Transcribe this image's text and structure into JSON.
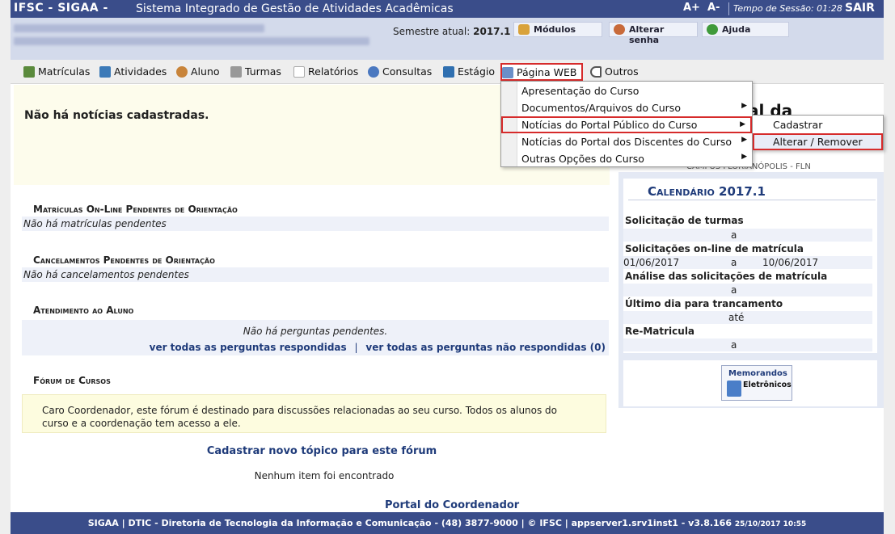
{
  "header": {
    "brand": "IFSC - SIGAA -",
    "system_name": "Sistema Integrado de Gestão de Atividades Acadêmicas",
    "font_increase": "A+",
    "font_decrease": "A-",
    "session_label": "Tempo de Sessão: 01:28",
    "exit_label": "SAIR"
  },
  "user": {
    "semester_label": "Semestre atual:",
    "semester_value": "2017.1",
    "buttons": {
      "modules": "Módulos",
      "change_password": "Alterar senha",
      "help": "Ajuda"
    }
  },
  "menu": [
    {
      "label": "Matrículas",
      "color": "#5a8a3c"
    },
    {
      "label": "Atividades",
      "color": "#3c7ab8"
    },
    {
      "label": "Aluno",
      "color": "#c8843a"
    },
    {
      "label": "Turmas",
      "color": "#999999"
    },
    {
      "label": "Relatórios",
      "color": "#cfcfcf"
    },
    {
      "label": "Consultas",
      "color": "#4a78c0"
    },
    {
      "label": "Estágio",
      "color": "#2f6fb0"
    },
    {
      "label": "Página WEB",
      "color": "#6a8fc8"
    },
    {
      "label": "Outros",
      "color": "#555555"
    }
  ],
  "dropdown": {
    "items": [
      {
        "label": "Apresentação do Curso",
        "submenu": false
      },
      {
        "label": "Documentos/Arquivos do Curso",
        "submenu": true
      },
      {
        "label": "Notícias do Portal Público do Curso",
        "submenu": true
      },
      {
        "label": "Notícias do Portal dos Discentes do Curso",
        "submenu": true
      },
      {
        "label": "Outras Opções do Curso",
        "submenu": true
      }
    ],
    "submenu": [
      "Cadastrar",
      "Alterar / Remover"
    ]
  },
  "news": {
    "message": "Não há notícias cadastradas."
  },
  "sections": {
    "matriculas": {
      "title": "Matrículas On-Line Pendentes de Orientação",
      "empty": "Não há matrículas pendentes"
    },
    "cancelamentos": {
      "title": "Cancelamentos Pendentes de Orientação",
      "empty": "Não há cancelamentos pendentes"
    },
    "atendimento": {
      "title": "Atendimento ao Aluno",
      "empty": "Não há perguntas pendentes.",
      "link_answered": "ver todas as perguntas respondidas",
      "separator": "|",
      "link_unanswered": "ver todas as perguntas não respondidas (0)"
    },
    "forum": {
      "title": "Fórum de Cursos",
      "note": "Caro Coordenador, este fórum é destinado para discussões relacionadas ao seu curso. Todos os alunos do curso e a coordenação tem acesso a ele.",
      "new_topic": "Cadastrar novo tópico para este fórum",
      "empty": "Nenhum item foi encontrado"
    }
  },
  "right": {
    "portal_title": "al da",
    "portal_sub": "CAMPUS FLORIANÓPOLIS - FLN",
    "calendar": {
      "title": "Calendário 2017.1",
      "entries": [
        {
          "label": "Solicitação de turmas",
          "start": "",
          "sep": "a",
          "end": ""
        },
        {
          "label": "Solicitações on-line de matrícula",
          "start": "01/06/2017",
          "sep": "a",
          "end": "10/06/2017"
        },
        {
          "label": "Análise das solicitações de matrícula",
          "start": "",
          "sep": "a",
          "end": ""
        },
        {
          "label": "Último dia para trancamento",
          "start": "",
          "sep": "até",
          "end": ""
        },
        {
          "label": "Re-Matricula",
          "start": "",
          "sep": "a",
          "end": ""
        }
      ]
    },
    "memo": {
      "line1": "Memorandos",
      "line2": "Eletrônicos"
    }
  },
  "footer": {
    "portal_link": "Portal do Coordenador",
    "text": "SIGAA | DTIC - Diretoria de Tecnologia da Informação e Comunicação - (48) 3877-9000 | © IFSC | appserver1.srv1inst1 - v3.8.166",
    "timestamp": "25/10/2017 10:55"
  }
}
